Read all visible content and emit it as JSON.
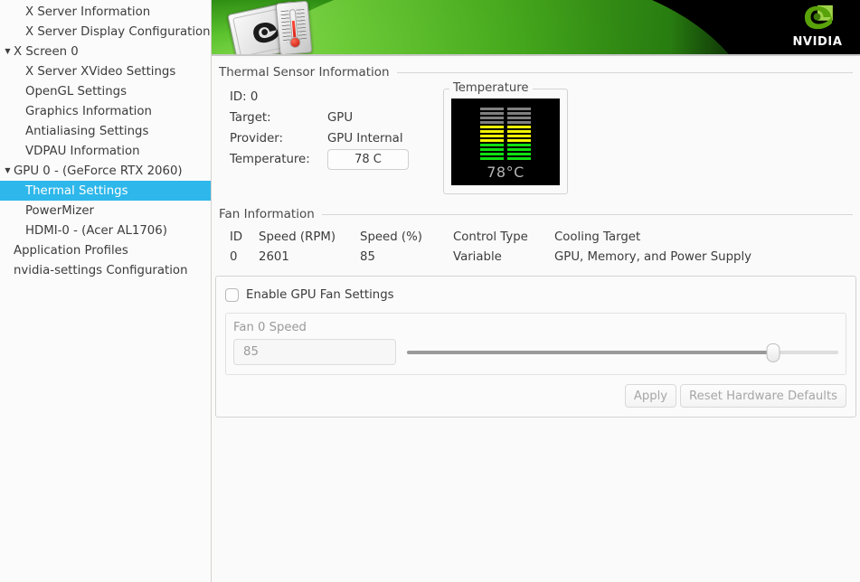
{
  "sidebar": {
    "items": [
      {
        "label": "X Server Information",
        "level": 1,
        "twisty": "",
        "selected": false
      },
      {
        "label": "X Server Display Configuration",
        "level": 1,
        "twisty": "",
        "selected": false
      },
      {
        "label": "X Screen 0",
        "level": 0,
        "twisty": "▼",
        "selected": false
      },
      {
        "label": "X Server XVideo Settings",
        "level": 1,
        "twisty": "",
        "selected": false
      },
      {
        "label": "OpenGL Settings",
        "level": 1,
        "twisty": "",
        "selected": false
      },
      {
        "label": "Graphics Information",
        "level": 1,
        "twisty": "",
        "selected": false
      },
      {
        "label": "Antialiasing Settings",
        "level": 1,
        "twisty": "",
        "selected": false
      },
      {
        "label": "VDPAU Information",
        "level": 1,
        "twisty": "",
        "selected": false
      },
      {
        "label": "GPU 0 - (GeForce RTX 2060)",
        "level": 0,
        "twisty": "▼",
        "selected": false
      },
      {
        "label": "Thermal Settings",
        "level": 1,
        "twisty": "",
        "selected": true
      },
      {
        "label": "PowerMizer",
        "level": 1,
        "twisty": "",
        "selected": false
      },
      {
        "label": "HDMI-0 - (Acer AL1706)",
        "level": 1,
        "twisty": "",
        "selected": false
      },
      {
        "label": "Application Profiles",
        "level": 0,
        "twisty": "",
        "selected": false
      },
      {
        "label": "nvidia-settings Configuration",
        "level": 0,
        "twisty": "",
        "selected": false
      }
    ]
  },
  "banner": {
    "brand_word": "NVIDIA",
    "icon_name": "thermal-card-icon",
    "logo_name": "nvidia-eye-logo"
  },
  "thermal": {
    "section_title": "Thermal Sensor Information",
    "id_label": "ID: 0",
    "target_label": "Target:",
    "target_value": "GPU",
    "provider_label": "Provider:",
    "provider_value": "GPU Internal",
    "temperature_label": "Temperature:",
    "temperature_value": "78 C",
    "gauge_legend": "Temperature",
    "gauge_reading": "78°C",
    "gauge_colors": {
      "gray": "#808080",
      "yellow": "#f2f200",
      "green": "#11e011",
      "screen": "#000000",
      "text": "#b4b4b4"
    },
    "gauge_segments": [
      "gray",
      "gray",
      "gray",
      "gray",
      "yellow",
      "yellow",
      "yellow",
      "yellow",
      "green",
      "green",
      "green",
      "green"
    ]
  },
  "fan": {
    "section_title": "Fan Information",
    "columns": [
      "ID",
      "Speed (RPM)",
      "Speed (%)",
      "Control Type",
      "Cooling Target"
    ],
    "rows": [
      {
        "id": "0",
        "rpm": "2601",
        "pct": "85",
        "control": "Variable",
        "cooling": "GPU, Memory, and Power Supply"
      }
    ],
    "enable_checkbox_label": "Enable GPU Fan Settings",
    "enable_checked": false,
    "fan_speed_label": "Fan 0 Speed",
    "fan_speed_value": "85",
    "slider_percent": 85,
    "apply_label": "Apply",
    "reset_label": "Reset Hardware Defaults"
  },
  "colors": {
    "selection": "#2eb7ea",
    "brand_green": "#76b900",
    "window_bg": "#fafafa"
  }
}
